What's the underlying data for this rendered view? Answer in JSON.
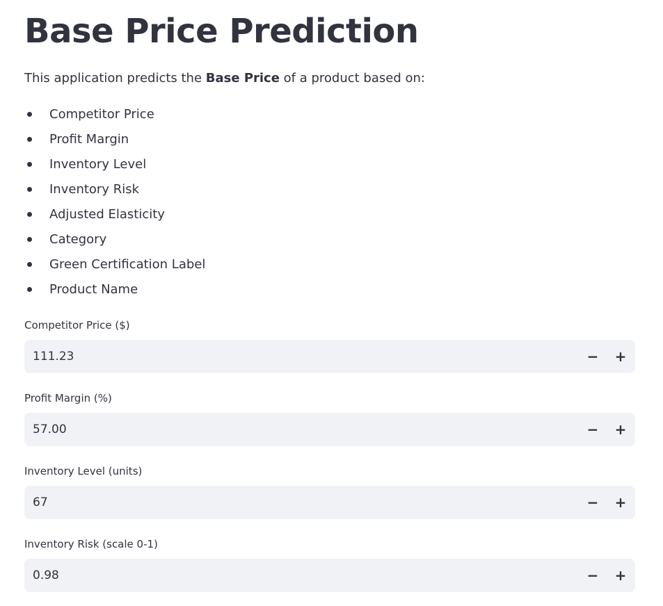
{
  "page": {
    "title": "Base Price Prediction",
    "intro_prefix": "This application predicts the ",
    "intro_bold": "Base Price",
    "intro_suffix": " of a product based on:"
  },
  "features": [
    "Competitor Price",
    "Profit Margin",
    "Inventory Level",
    "Inventory Risk",
    "Adjusted Elasticity",
    "Category",
    "Green Certification Label",
    "Product Name"
  ],
  "inputs": [
    {
      "label": "Competitor Price ($)",
      "value": "111.23",
      "minus": "−",
      "plus": "+"
    },
    {
      "label": "Profit Margin (%)",
      "value": "57.00",
      "minus": "−",
      "plus": "+"
    },
    {
      "label": "Inventory Level (units)",
      "value": "67",
      "minus": "−",
      "plus": "+"
    },
    {
      "label": "Inventory Risk (scale 0-1)",
      "value": "0.98",
      "minus": "−",
      "plus": "+"
    }
  ],
  "colors": {
    "text": "#31333f",
    "input_bg": "#f0f2f6",
    "background": "#ffffff"
  }
}
